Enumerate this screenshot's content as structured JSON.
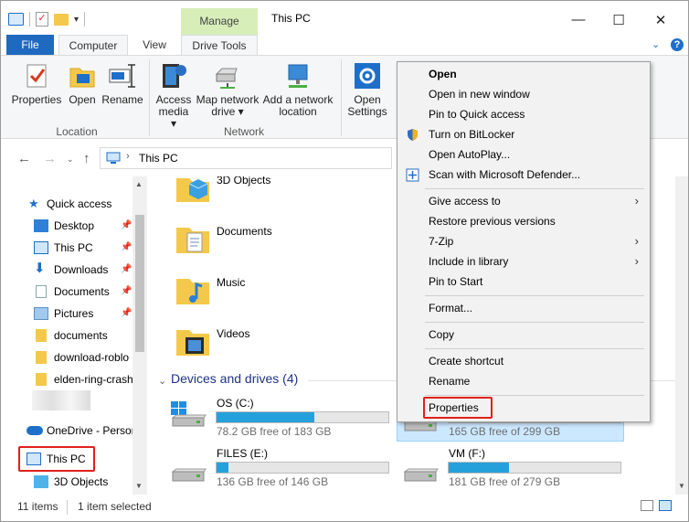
{
  "window": {
    "title": "This PC",
    "manage_tab": "Manage"
  },
  "ribbon_tabs": [
    {
      "label": "File"
    },
    {
      "label": "Computer"
    },
    {
      "label": "View"
    },
    {
      "label": "Drive Tools"
    }
  ],
  "ribbon": {
    "location": {
      "group_label": "Location",
      "buttons": [
        "Properties",
        "Open",
        "Rename"
      ]
    },
    "network": {
      "group_label": "Network",
      "access_media": [
        "Access",
        "media"
      ],
      "map_network_drive": [
        "Map network",
        "drive"
      ],
      "add_network_location": [
        "Add a network",
        "location"
      ]
    },
    "system": {
      "open_settings": [
        "Open",
        "Settings"
      ]
    }
  },
  "address": {
    "path": "This PC"
  },
  "nav": {
    "quick_access": "Quick access",
    "items": [
      {
        "label": "Desktop",
        "icon": "desktop-icon",
        "pinned": true
      },
      {
        "label": "This PC",
        "icon": "computer-icon",
        "pinned": true
      },
      {
        "label": "Downloads",
        "icon": "download-icon",
        "pinned": true
      },
      {
        "label": "Documents",
        "icon": "documents-icon",
        "pinned": true
      },
      {
        "label": "Pictures",
        "icon": "pictures-icon",
        "pinned": true
      },
      {
        "label": "documents",
        "icon": "folder-icon",
        "pinned": false
      },
      {
        "label": "download-roblo",
        "icon": "folder-icon",
        "pinned": false
      },
      {
        "label": "elden-ring-crash",
        "icon": "folder-icon",
        "pinned": false
      }
    ],
    "onedrive": "OneDrive - Person",
    "this_pc": "This PC",
    "objects_3d": "3D Objects"
  },
  "folders": [
    {
      "label": "3D Objects"
    },
    {
      "label": "Documents"
    },
    {
      "label": "Music"
    },
    {
      "label": "Videos"
    }
  ],
  "devices_section": {
    "title": "Devices and drives (4)"
  },
  "drives": [
    {
      "name": "OS (C:)",
      "free": "78.2 GB free of 183 GB",
      "used_fraction": 0.57
    },
    {
      "name": "",
      "free": "165 GB free of 299 GB",
      "used_fraction": 0.45
    },
    {
      "name": "FILES (E:)",
      "free": "136 GB free of 146 GB",
      "used_fraction": 0.07
    },
    {
      "name": "VM (F:)",
      "free": "181 GB free of 279 GB",
      "used_fraction": 0.35
    }
  ],
  "status": {
    "items_count": "11 items",
    "selected": "1 item selected"
  },
  "context_menu": {
    "items": [
      {
        "label": "Open",
        "bold": true
      },
      {
        "label": "Open in new window"
      },
      {
        "label": "Pin to Quick access"
      },
      {
        "label": "Turn on BitLocker",
        "icon": "shield-icon"
      },
      {
        "label": "Open AutoPlay..."
      },
      {
        "label": "Scan with Microsoft Defender...",
        "icon": "defender-icon"
      },
      {
        "label": "Give access to",
        "submenu": true
      },
      {
        "label": "Restore previous versions"
      },
      {
        "label": "7-Zip",
        "submenu": true
      },
      {
        "label": "Include in library",
        "submenu": true
      },
      {
        "label": "Pin to Start"
      },
      {
        "label": "Format..."
      },
      {
        "label": "Copy"
      },
      {
        "label": "Create shortcut"
      },
      {
        "label": "Rename"
      },
      {
        "label": "Properties",
        "highlighted": true
      }
    ]
  },
  "colors": {
    "accent": "#1f6ac0",
    "drive_bar": "#26a0da",
    "highlight_red": "#e0201c",
    "manage_tab": "#d7eeb9"
  }
}
